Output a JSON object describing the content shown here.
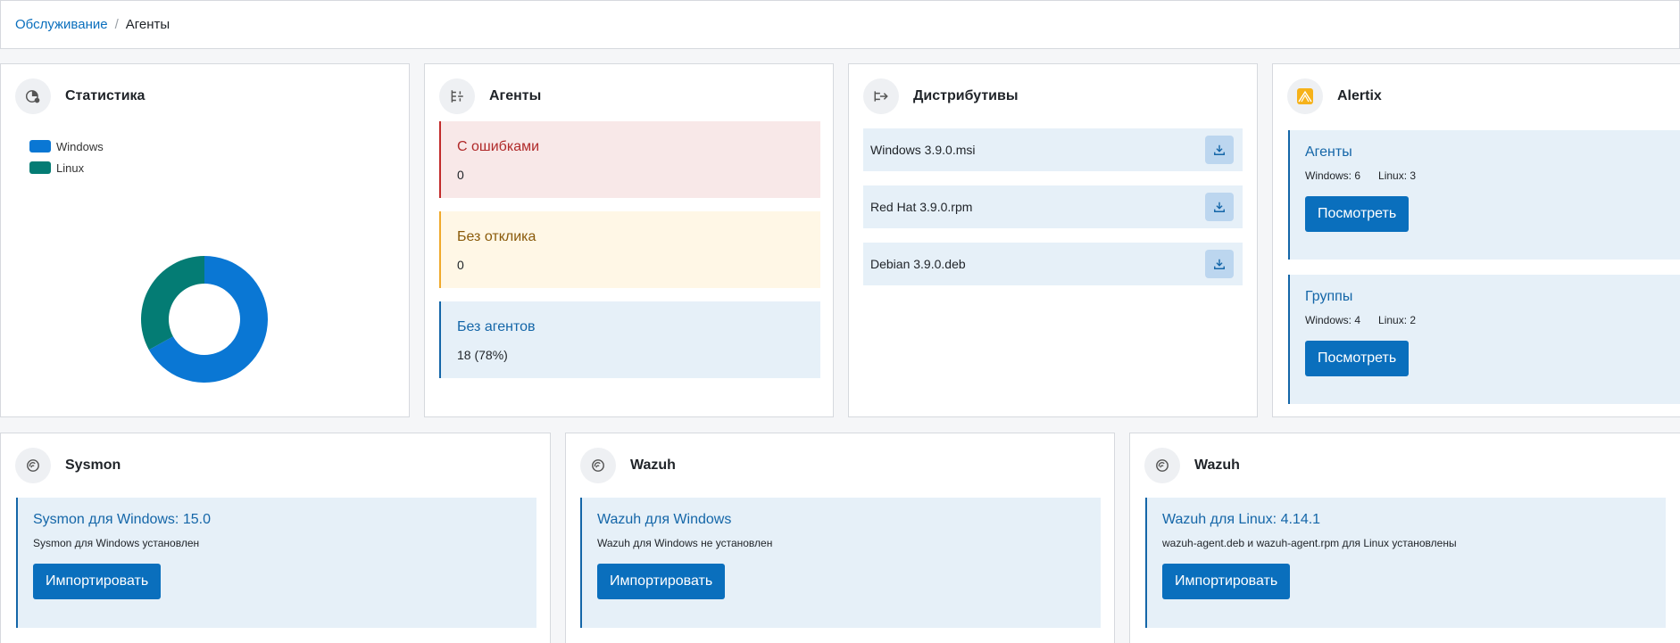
{
  "breadcrumb": {
    "parent": "Обслуживание",
    "separator": "/",
    "current": "Агенты"
  },
  "colors": {
    "accent": "#0a6fbd",
    "windows": "#0a77d4",
    "linux": "#047c74",
    "error": "#c22b2b",
    "warning": "#f0a92b",
    "info": "#1466a8"
  },
  "statistics": {
    "title": "Статистика",
    "icon": "chart-icon",
    "chart_data": {
      "type": "pie",
      "donut": true,
      "labels": [
        "Windows",
        "Linux"
      ],
      "values": [
        0.67,
        0.33
      ],
      "colors": [
        "#0a77d4",
        "#047c74"
      ],
      "legend_position": "top-left"
    }
  },
  "agents": {
    "title": "Агенты",
    "icon": "agents-icon",
    "statuses": [
      {
        "label": "С ошибками",
        "value": "0"
      },
      {
        "label": "Без отклика",
        "value": "0"
      },
      {
        "label": "Без агентов",
        "value": "18 (78%)"
      }
    ]
  },
  "distributions": {
    "title": "Дистрибутивы",
    "icon": "distribution-icon",
    "items": [
      {
        "name": "Windows 3.9.0.msi",
        "icon": "download-icon"
      },
      {
        "name": "Red Hat 3.9.0.rpm",
        "icon": "download-icon"
      },
      {
        "name": "Debian 3.9.0.deb",
        "icon": "download-icon"
      }
    ]
  },
  "alertix": {
    "title": "Alertix",
    "icon": "alertix-logo",
    "panels": [
      {
        "title": "Агенты",
        "windows": "Windows: 6",
        "linux": "Linux: 3",
        "button": "Посмотреть"
      },
      {
        "title": "Группы",
        "windows": "Windows: 4",
        "linux": "Linux: 2",
        "button": "Посмотреть"
      }
    ]
  },
  "software": [
    {
      "title": "Sysmon",
      "icon": "sysmon-icon",
      "heading": "Sysmon для Windows: 15.0",
      "status": "Sysmon для Windows установлен",
      "button": "Импортировать"
    },
    {
      "title": "Wazuh",
      "icon": "wazuh-icon",
      "heading": "Wazuh для Windows",
      "status": "Wazuh для Windows не установлен",
      "button": "Импортировать"
    },
    {
      "title": "Wazuh",
      "icon": "wazuh-icon",
      "heading": "Wazuh для Linux: 4.14.1",
      "status": "wazuh-agent.deb и wazuh-agent.rpm для Linux установлены",
      "button": "Импортировать"
    }
  ]
}
